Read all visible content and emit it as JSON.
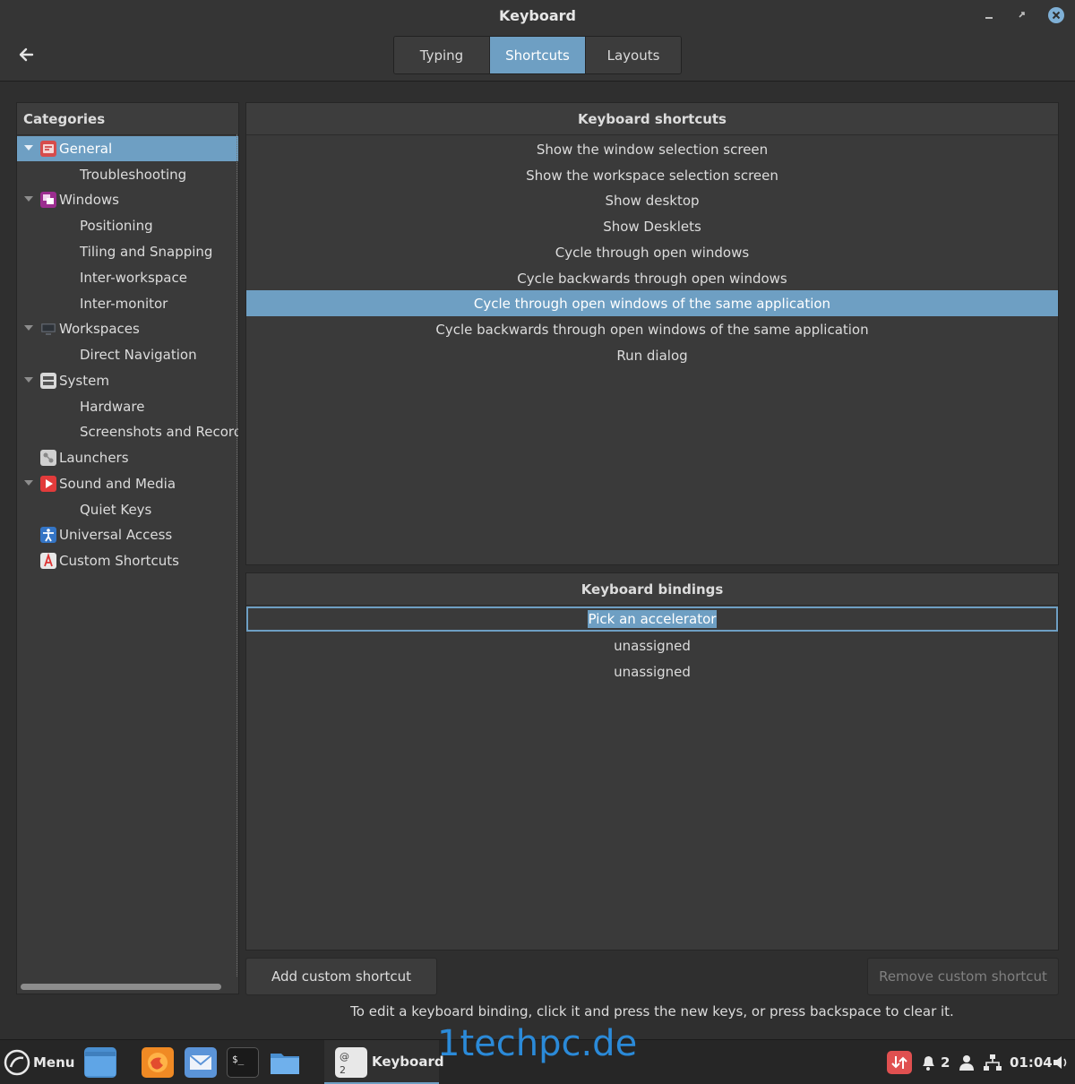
{
  "window": {
    "title": "Keyboard",
    "controls": [
      "minimize-icon",
      "maximize-icon",
      "close-icon"
    ],
    "accent": "#6e9fc3"
  },
  "tabs": [
    {
      "label": "Typing",
      "active": false
    },
    {
      "label": "Shortcuts",
      "active": true
    },
    {
      "label": "Layouts",
      "active": false
    }
  ],
  "categories": {
    "header": "Categories",
    "items": [
      {
        "label": "General",
        "icon": "general-icon",
        "expanded": true,
        "selected": true
      },
      {
        "label": "Troubleshooting"
      },
      {
        "label": "Windows",
        "icon": "windows-icon",
        "expanded": true
      },
      {
        "label": "Positioning"
      },
      {
        "label": "Tiling and Snapping"
      },
      {
        "label": "Inter-workspace"
      },
      {
        "label": "Inter-monitor"
      },
      {
        "label": "Workspaces",
        "icon": "workspaces-icon",
        "expanded": true
      },
      {
        "label": "Direct Navigation"
      },
      {
        "label": "System",
        "icon": "system-icon",
        "expanded": true
      },
      {
        "label": "Hardware"
      },
      {
        "label": "Screenshots and Recordir"
      },
      {
        "label": "Launchers",
        "icon": "launchers-icon"
      },
      {
        "label": "Sound and Media",
        "icon": "sound-media-icon",
        "expanded": true
      },
      {
        "label": "Quiet Keys"
      },
      {
        "label": "Universal Access",
        "icon": "universal-access-icon"
      },
      {
        "label": "Custom Shortcuts",
        "icon": "custom-shortcuts-icon"
      }
    ]
  },
  "shortcuts": {
    "header": "Keyboard shortcuts",
    "items": [
      "Show the window selection screen",
      "Show the workspace selection screen",
      "Show desktop",
      "Show Desklets",
      "Cycle through open windows",
      "Cycle backwards through open windows",
      "Cycle through open windows of the same application",
      "Cycle backwards through open windows of the same application",
      "Run dialog"
    ],
    "selected_index": 6
  },
  "bindings": {
    "header": "Keyboard bindings",
    "editing": "Pick an accelerator",
    "items": [
      "unassigned",
      "unassigned"
    ]
  },
  "buttons": {
    "add": "Add custom shortcut",
    "remove": "Remove custom shortcut"
  },
  "hint": "To edit a keyboard binding, click it and press the new keys, or press backspace to clear it.",
  "taskbar": {
    "menu_label": "Menu",
    "window_label": "Keyboard",
    "workspace_badge": "2",
    "clock": "01:04",
    "watermark": "1techpc.de"
  }
}
